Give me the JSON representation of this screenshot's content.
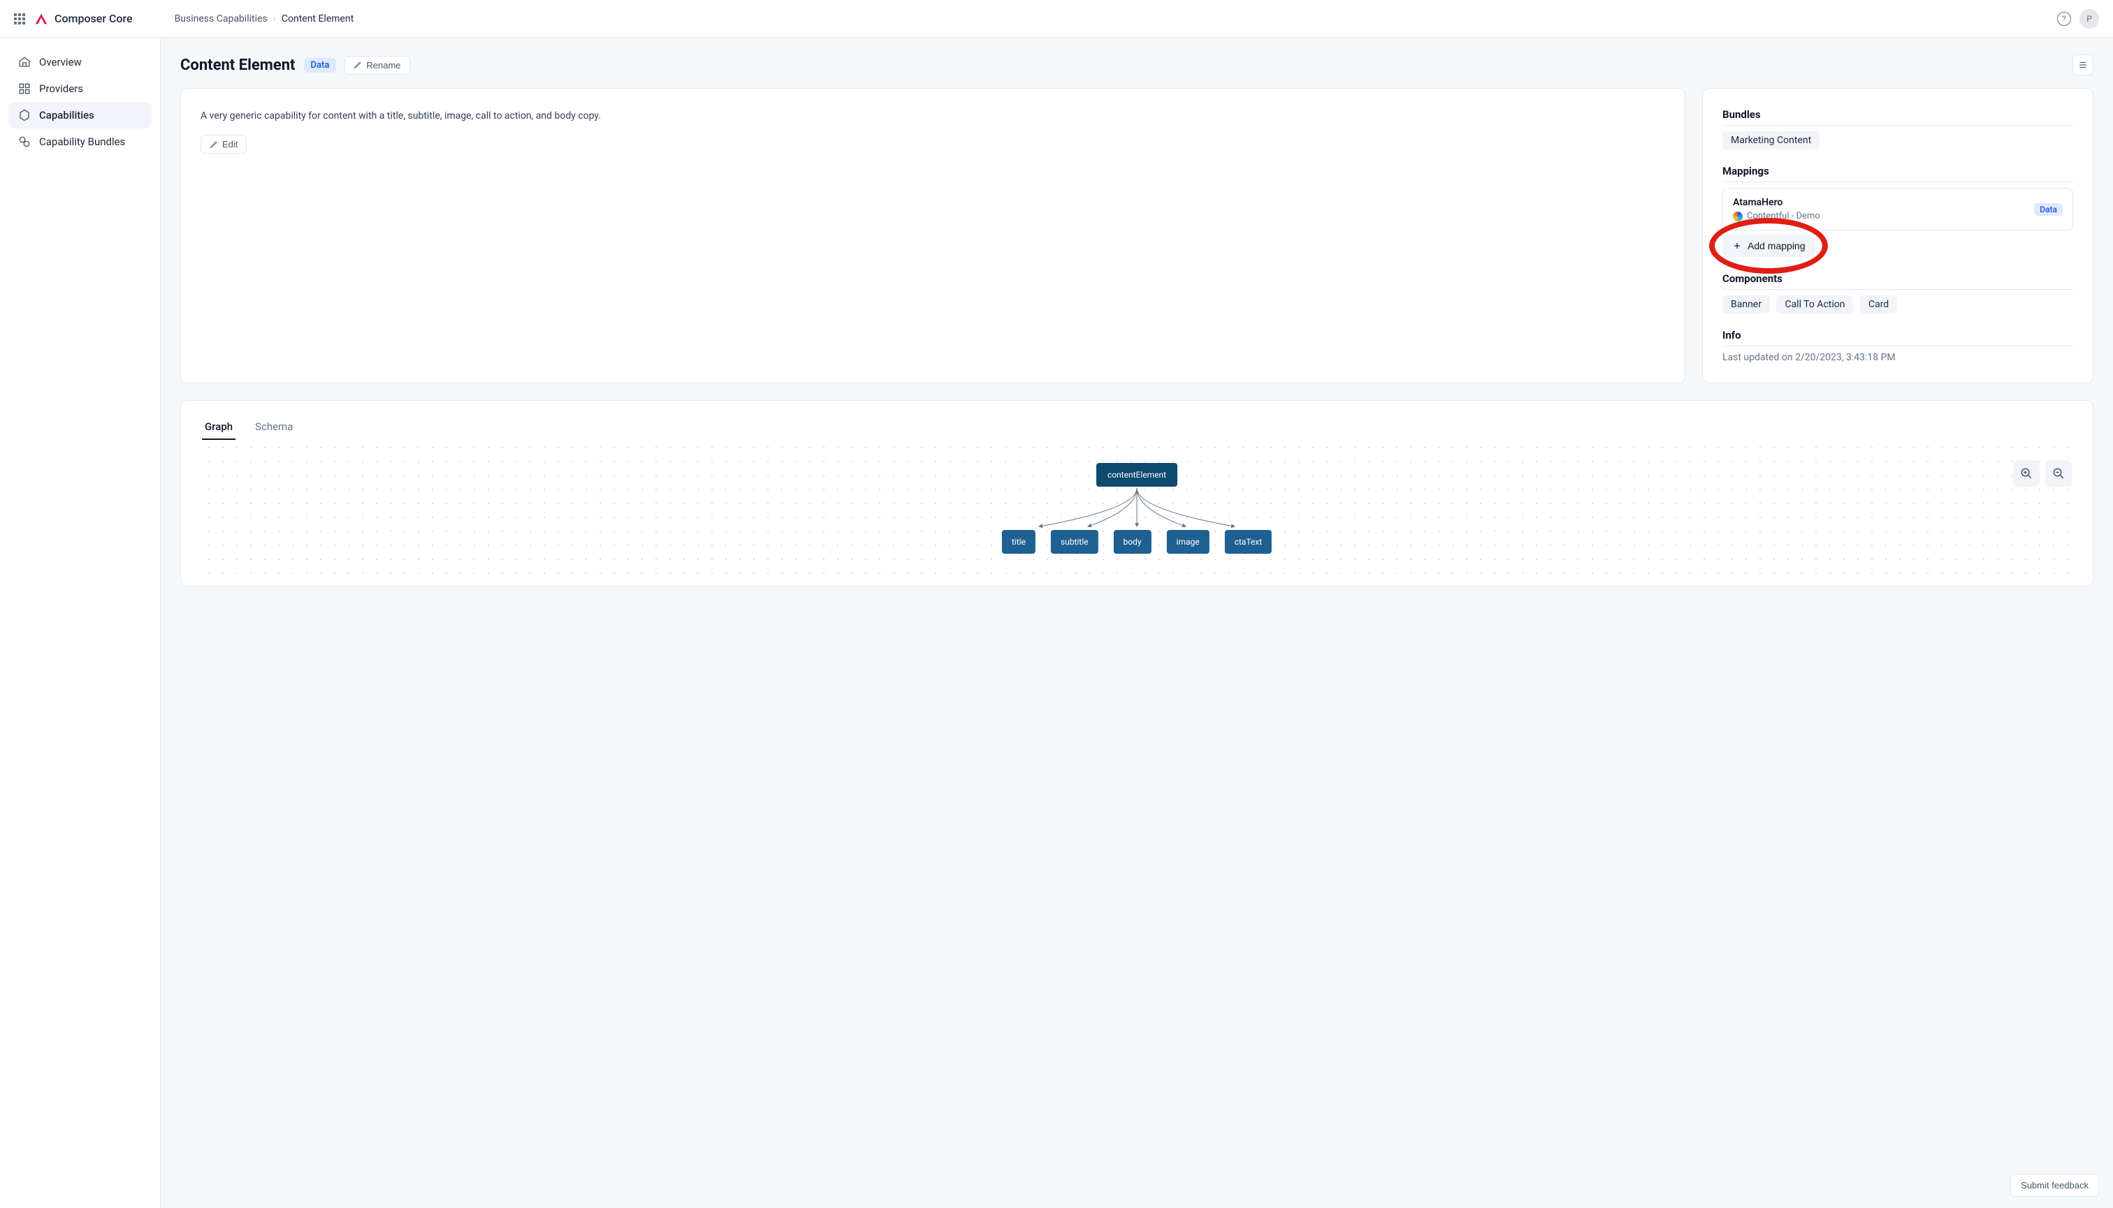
{
  "app": {
    "title": "Composer Core",
    "avatar_initial": "P"
  },
  "breadcrumb": {
    "parent": "Business Capabilities",
    "current": "Content Element"
  },
  "sidebar": {
    "items": [
      {
        "label": "Overview"
      },
      {
        "label": "Providers"
      },
      {
        "label": "Capabilities"
      },
      {
        "label": "Capability Bundles"
      }
    ]
  },
  "page": {
    "title": "Content Element",
    "badge": "Data",
    "rename_label": "Rename",
    "description": "A very generic capability for content with a title, subtitle, image, call to action, and body copy.",
    "edit_label": "Edit"
  },
  "side": {
    "bundles_title": "Bundles",
    "bundles": [
      "Marketing Content"
    ],
    "mappings_title": "Mappings",
    "mappings": [
      {
        "name": "AtamaHero",
        "provider": "Contentful - Demo",
        "badge": "Data"
      }
    ],
    "add_mapping_label": "Add mapping",
    "components_title": "Components",
    "components": [
      "Banner",
      "Call To Action",
      "Card"
    ],
    "info_title": "Info",
    "info_text": "Last updated on 2/20/2023, 3:43:18 PM"
  },
  "graph": {
    "tabs": [
      "Graph",
      "Schema"
    ],
    "root": "contentElement",
    "children": [
      "title",
      "subtitle",
      "body",
      "image",
      "ctaText"
    ]
  },
  "feedback_label": "Submit feedback"
}
